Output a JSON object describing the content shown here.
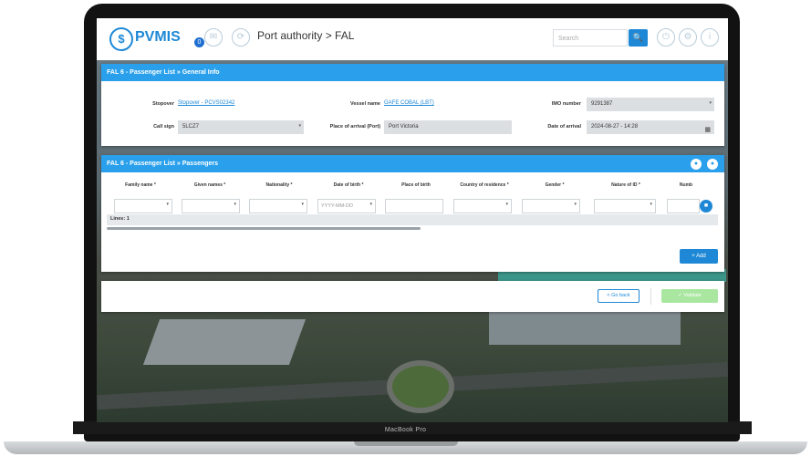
{
  "app": {
    "logo_text": "PVMIS",
    "logo_icon": "$",
    "breadcrumb": "Port authority > FAL",
    "notification_count": "0"
  },
  "search": {
    "placeholder": "Search"
  },
  "general_info": {
    "title": "FAL 6 - Passenger List » General Info",
    "stopover_label": "Stopover",
    "stopover_value": "Stopover - PCVS02342",
    "vessel_label": "Vessel name",
    "vessel_value": "GAFE COBAL (LBT)",
    "imo_label": "IMO number",
    "imo_value": "9291387",
    "callsign_label": "Call sign",
    "callsign_value": "5LCZ7",
    "place_label": "Place of arrival (Port)",
    "place_value": "Port Victoria",
    "date_label": "Date of arrival",
    "date_value": "2024-08-27 - 14:28"
  },
  "passengers": {
    "title": "FAL 6 - Passenger List » Passengers",
    "columns": [
      "Family name *",
      "Given names *",
      "Nationality *",
      "Date of birth *",
      "Place of birth",
      "Country of residence *",
      "Gender *",
      "Nature of ID *",
      "Numb"
    ],
    "date_placeholder": "YYYY-MM-DD",
    "lines_label": "Lines: 1",
    "add_label": "+ Add"
  },
  "footer": {
    "back_label": "< Go back",
    "validate_label": "✓ Validate"
  },
  "device": {
    "brand": "MacBook Pro"
  }
}
